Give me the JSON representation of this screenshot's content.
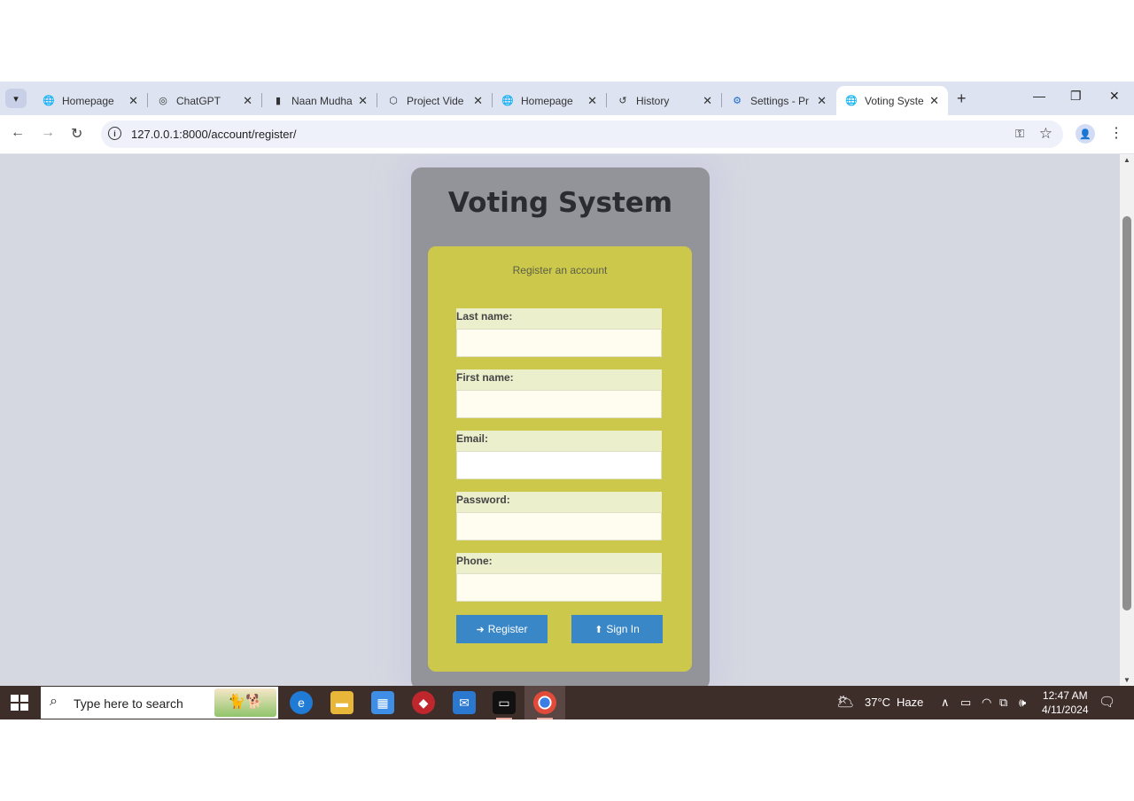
{
  "browser": {
    "tabs": [
      {
        "label": "Homepage",
        "icon": "globe-icon",
        "glyph": "🌐"
      },
      {
        "label": "ChatGPT",
        "icon": "chatgpt-icon",
        "glyph": "◎"
      },
      {
        "label": "Naan Mudha",
        "icon": "naan-mudhalvan-icon",
        "glyph": "▮"
      },
      {
        "label": "Project Vide",
        "icon": "hexagon-icon",
        "glyph": "⬡"
      },
      {
        "label": "Homepage",
        "icon": "globe-icon",
        "glyph": "🌐"
      },
      {
        "label": "History",
        "icon": "history-icon",
        "glyph": "↺"
      },
      {
        "label": "Settings - Pr",
        "icon": "gear-icon",
        "glyph": "⚙"
      },
      {
        "label": "Voting Syste",
        "icon": "globe-icon",
        "glyph": "🌐"
      }
    ],
    "active_tab_index": 7,
    "url": "127.0.0.1:8000/account/register/"
  },
  "page": {
    "title": "Voting System",
    "subtitle": "Register an account",
    "fields": [
      {
        "label": "Last name:",
        "value": ""
      },
      {
        "label": "First name:",
        "value": ""
      },
      {
        "label": "Email:",
        "value": ""
      },
      {
        "label": "Password:",
        "value": ""
      },
      {
        "label": "Phone:",
        "value": ""
      }
    ],
    "register_label": "Register",
    "signin_label": "Sign In"
  },
  "taskbar": {
    "search_placeholder": "Type here to search",
    "weather_temp": "37°C",
    "weather_desc": "Haze",
    "time": "12:47 AM",
    "date": "4/11/2024"
  },
  "colors": {
    "card_bg": "#939499",
    "form_bg": "#ccc84b",
    "button_bg": "#3a87c7",
    "page_bg": "#d5d8e1"
  }
}
